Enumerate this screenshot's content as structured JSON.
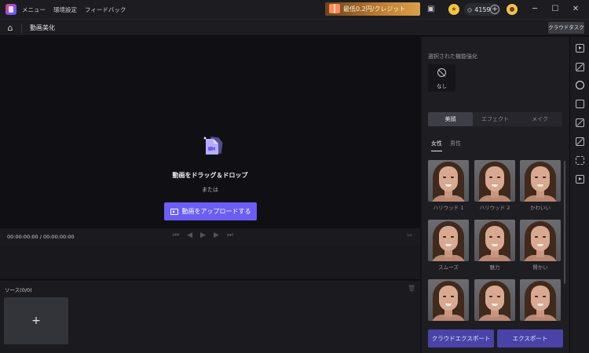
{
  "titlebar": {
    "menu": [
      "メニュー",
      "環境設定",
      "フィードバック"
    ],
    "promo_text": "最低0.2円/クレジット",
    "credits": "4159",
    "credits_plus": "+"
  },
  "subheader": {
    "title": "動画美化",
    "cloud_task": "クラウドタスク"
  },
  "preview": {
    "drop_title": "動画をドラッグ＆ドロップ",
    "or_text": "または",
    "upload_label": "動画をアップロードする"
  },
  "timeline": {
    "time": "00:00:00:00 / 00:00:00:00"
  },
  "source": {
    "title": "ソース(0/0)",
    "add": "+"
  },
  "panel": {
    "section_title": "選択された機能強化",
    "none_label": "なし",
    "tabs": [
      {
        "label": "美顔",
        "active": true
      },
      {
        "label": "エフェクト",
        "active": false
      },
      {
        "label": "メイク",
        "active": false
      }
    ],
    "gender": [
      {
        "label": "女性",
        "active": true
      },
      {
        "label": "男性",
        "active": false
      }
    ],
    "presets": [
      "ハリウッド 1",
      "ハリウッド 2",
      "かわいい",
      "スムーズ",
      "魅力",
      "賢かい",
      "",
      "",
      ""
    ],
    "cloud_export": "クラウドエクスポート",
    "export": "エクスポート"
  },
  "colors": {
    "accent": "#6b5ef5",
    "export_button": "#4a42a6",
    "promo": "#c27f34"
  }
}
